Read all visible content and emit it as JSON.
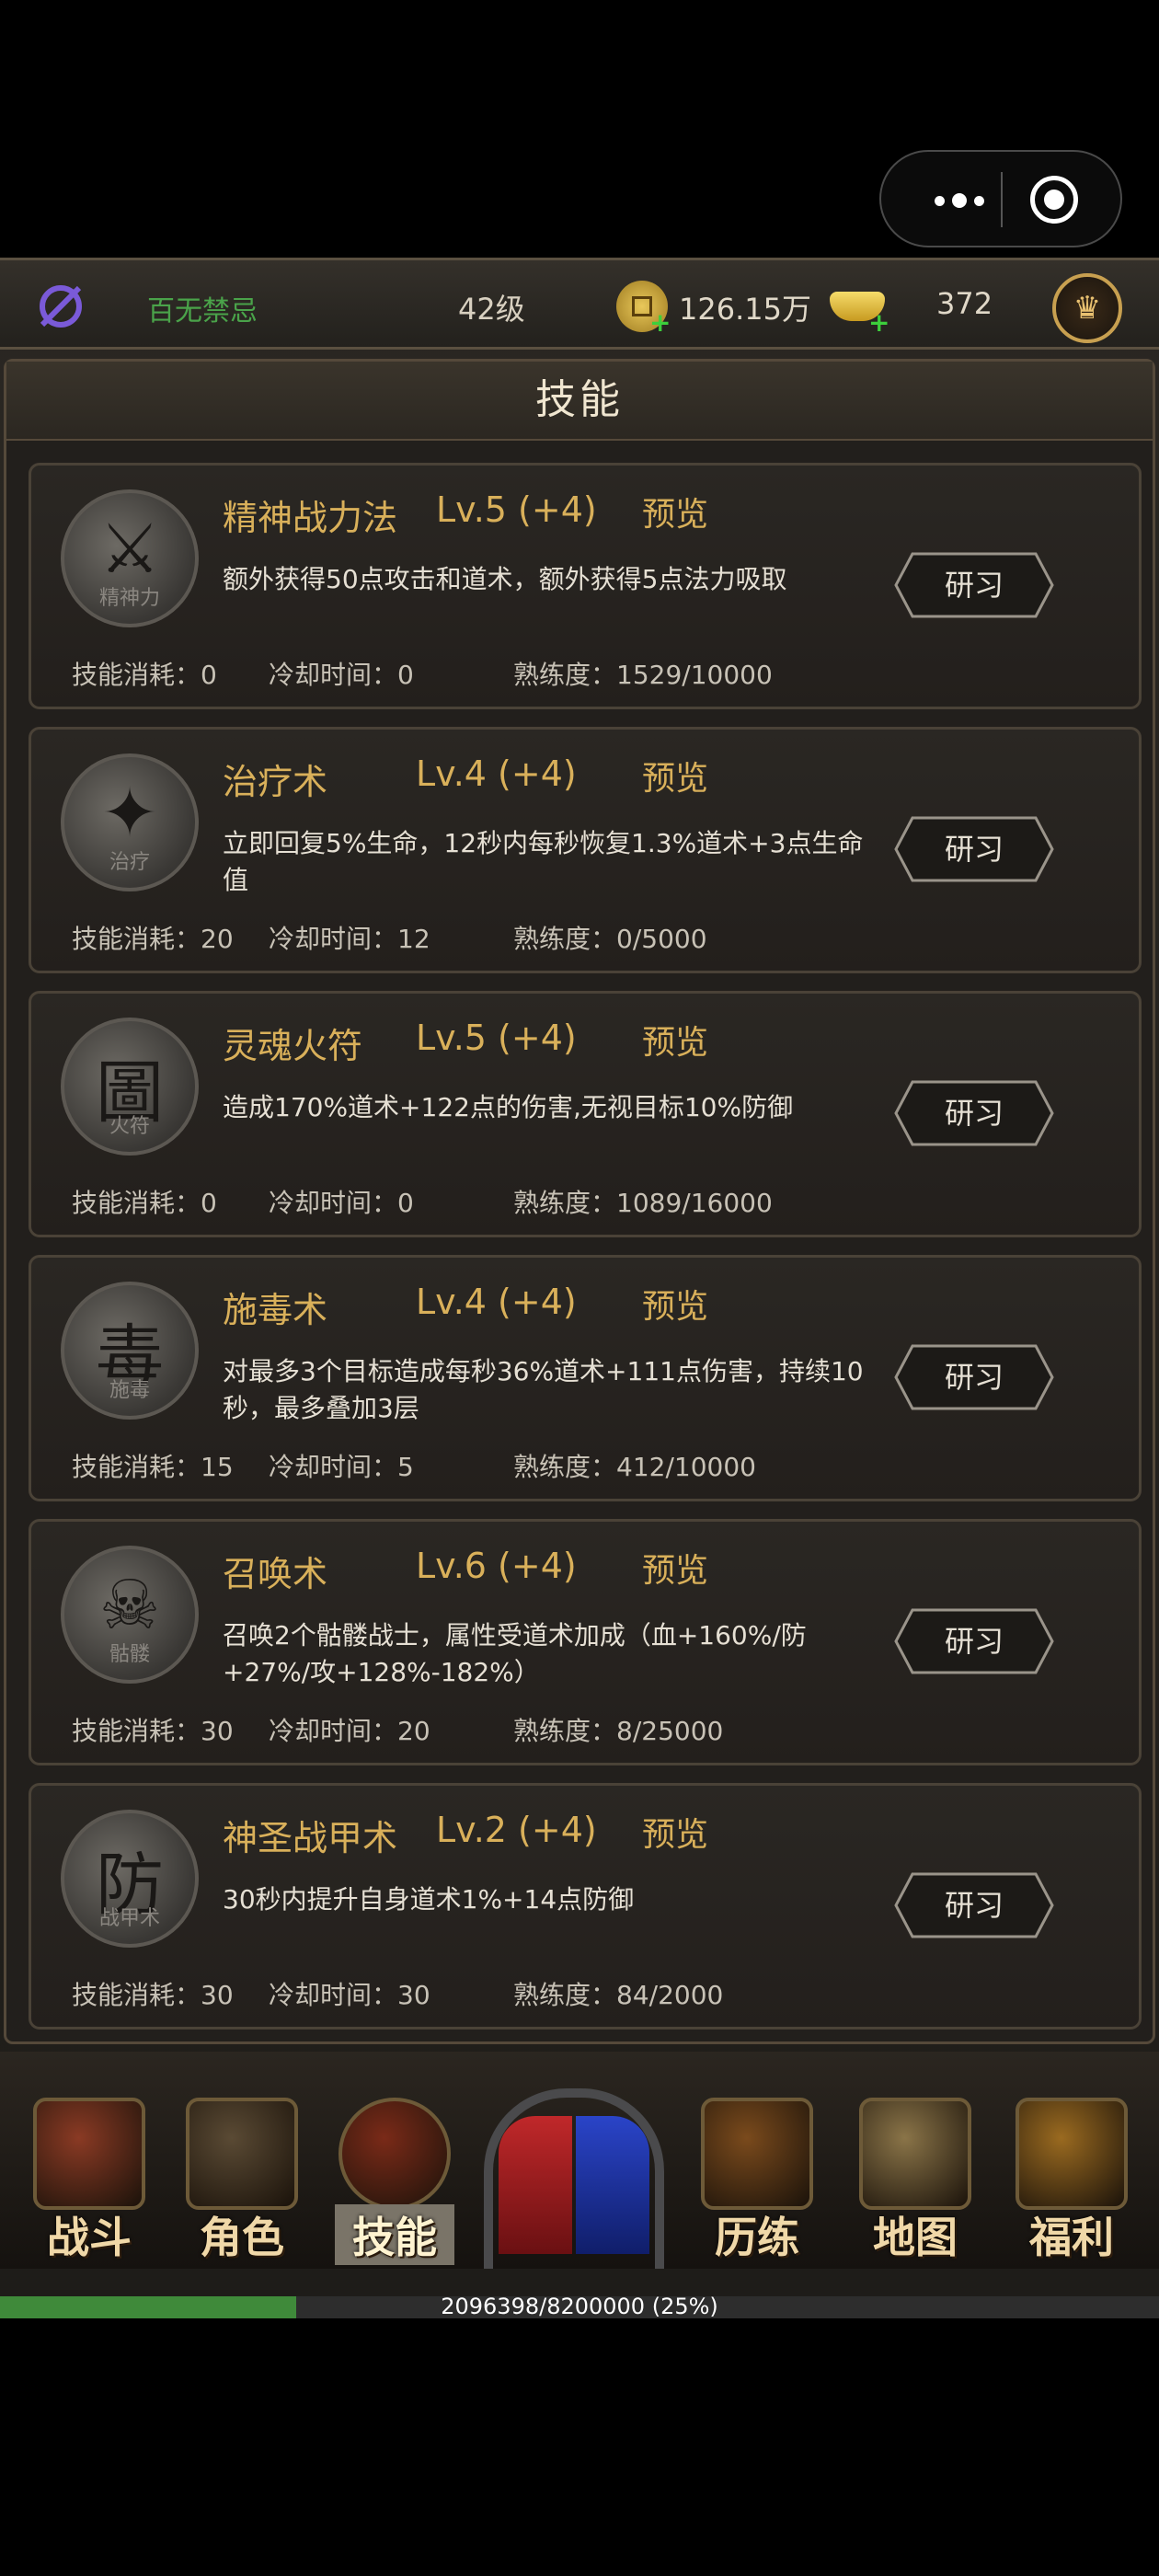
{
  "topbar": {
    "player_name": "百无禁忌",
    "level": "42级",
    "gold": "126.15万",
    "ingots": "372"
  },
  "panel": {
    "title": "技能"
  },
  "skills": [
    {
      "name": "精神战力法",
      "level": "Lv.5 (+4)",
      "preview": "预览",
      "icon_glyph": "⚔",
      "icon_label": "精神力",
      "desc": "额外获得50点攻击和道术，额外获得5点法力吸取",
      "cost": "技能消耗：0",
      "cooldown": "冷却时间：0",
      "mastery": "熟练度：1529/10000",
      "study": "研习"
    },
    {
      "name": "治疗术",
      "level": "Lv.4 (+4)",
      "preview": "预览",
      "icon_glyph": "✦",
      "icon_label": "治疗",
      "desc": "立即回复5%生命，12秒内每秒恢复1.3%道术+3点生命值",
      "cost": "技能消耗：20",
      "cooldown": "冷却时间：12",
      "mastery": "熟练度：0/5000",
      "study": "研习"
    },
    {
      "name": "灵魂火符",
      "level": "Lv.5 (+4)",
      "preview": "预览",
      "icon_glyph": "圖",
      "icon_label": "火符",
      "desc": "造成170%道术+122点的伤害,无视目标10%防御",
      "cost": "技能消耗：0",
      "cooldown": "冷却时间：0",
      "mastery": "熟练度：1089/16000",
      "study": "研习"
    },
    {
      "name": "施毒术",
      "level": "Lv.4 (+4)",
      "preview": "预览",
      "icon_glyph": "毒",
      "icon_label": "施毒",
      "desc": "对最多3个目标造成每秒36%道术+111点伤害，持续10秒，最多叠加3层",
      "cost": "技能消耗：15",
      "cooldown": "冷却时间：5",
      "mastery": "熟练度：412/10000",
      "study": "研习"
    },
    {
      "name": "召唤术",
      "level": "Lv.6 (+4)",
      "preview": "预览",
      "icon_glyph": "☠",
      "icon_label": "骷髅",
      "desc": "召唤2个骷髅战士，属性受道术加成（血+160%/防+27%/攻+128%-182%）",
      "cost": "技能消耗：30",
      "cooldown": "冷却时间：20",
      "mastery": "熟练度：8/25000",
      "study": "研习"
    },
    {
      "name": "神圣战甲术",
      "level": "Lv.2 (+4)",
      "preview": "预览",
      "icon_glyph": "防",
      "icon_label": "战甲术",
      "desc": "30秒内提升自身道术1%+14点防御",
      "cost": "技能消耗：30",
      "cooldown": "冷却时间：30",
      "mastery": "熟练度：84/2000",
      "study": "研习"
    }
  ],
  "nav": [
    {
      "label": "战斗",
      "color": "#8a3a24"
    },
    {
      "label": "角色",
      "color": "#5a4a34"
    },
    {
      "label": "技能",
      "color": "#7a2a18"
    },
    {
      "label": "历练",
      "color": "#7a4a1c"
    },
    {
      "label": "地图",
      "color": "#8a7448"
    },
    {
      "label": "福利",
      "color": "#9a6a20"
    }
  ],
  "xp": {
    "text": "2096398/8200000 (25%)",
    "fraction": 0.2557
  }
}
